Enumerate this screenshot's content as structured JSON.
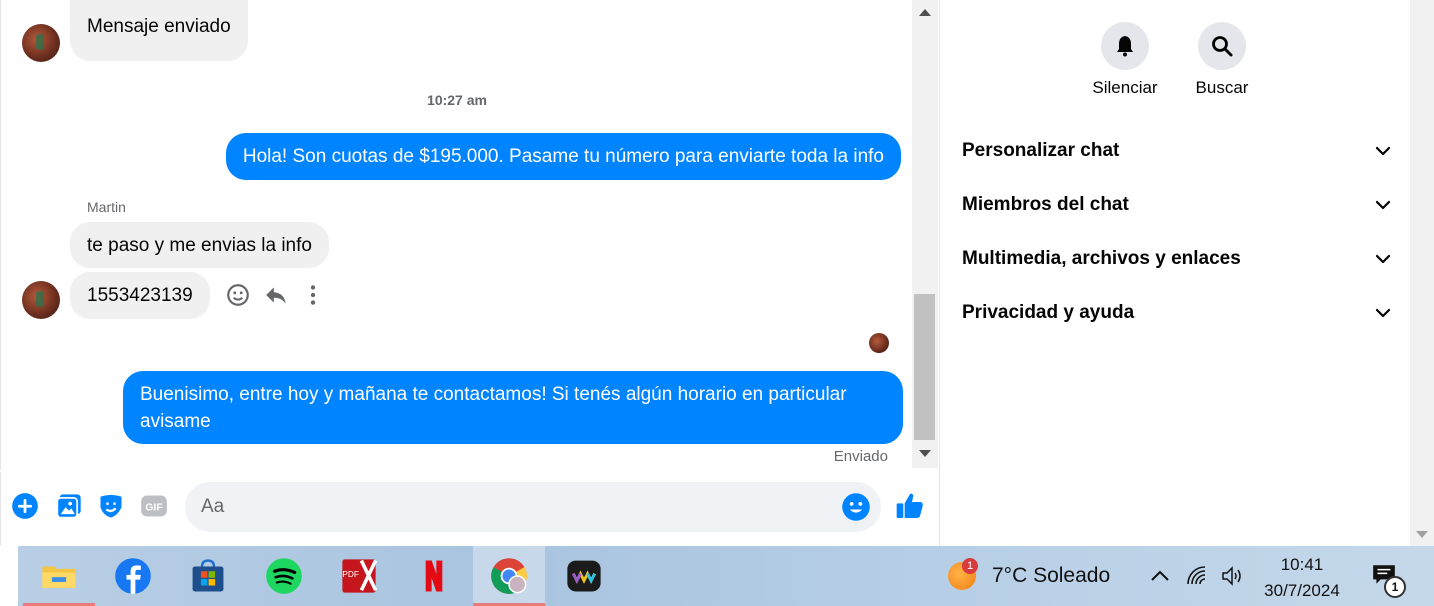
{
  "chat": {
    "top_message": "Mensaje enviado",
    "timestamp": "10:27 am",
    "outgoing_1": "Hola! Son cuotas de $195.000. Pasame tu número para enviarte toda la info",
    "sender_name": "Martin",
    "incoming_1": "te paso y me envias la info",
    "incoming_2": "1553423139",
    "outgoing_2_line1": "Buenisimo, entre hoy y mañana te contactamos! Si tenés algún horario en particular",
    "outgoing_2_line2": "avisame",
    "sent_status": "Enviado"
  },
  "composer": {
    "placeholder": "Aa",
    "icons": [
      "plus-circle-icon",
      "photo-icon",
      "sticker-icon",
      "gif-icon",
      "emoji-icon",
      "thumbs-up-icon"
    ]
  },
  "right_panel": {
    "mute_label": "Silenciar",
    "search_label": "Buscar",
    "sections": [
      "Personalizar chat",
      "Miembros del chat",
      "Multimedia, archivos y enlaces",
      "Privacidad y ayuda"
    ]
  },
  "taskbar": {
    "apps": [
      "file-explorer-icon",
      "facebook-icon",
      "microsoft-store-icon",
      "spotify-icon",
      "pdf-editor-icon",
      "netflix-icon",
      "chrome-icon",
      "media-app-icon"
    ],
    "pdf_label": "PDF",
    "weather_badge": "1",
    "weather_text": "7°C  Soleado",
    "time": "10:41",
    "date": "30/7/2024",
    "notification_count": "1"
  },
  "colors": {
    "messenger_blue": "#0084ff",
    "bubble_gray": "#f0f0f0",
    "secondary_text": "#65676b"
  }
}
